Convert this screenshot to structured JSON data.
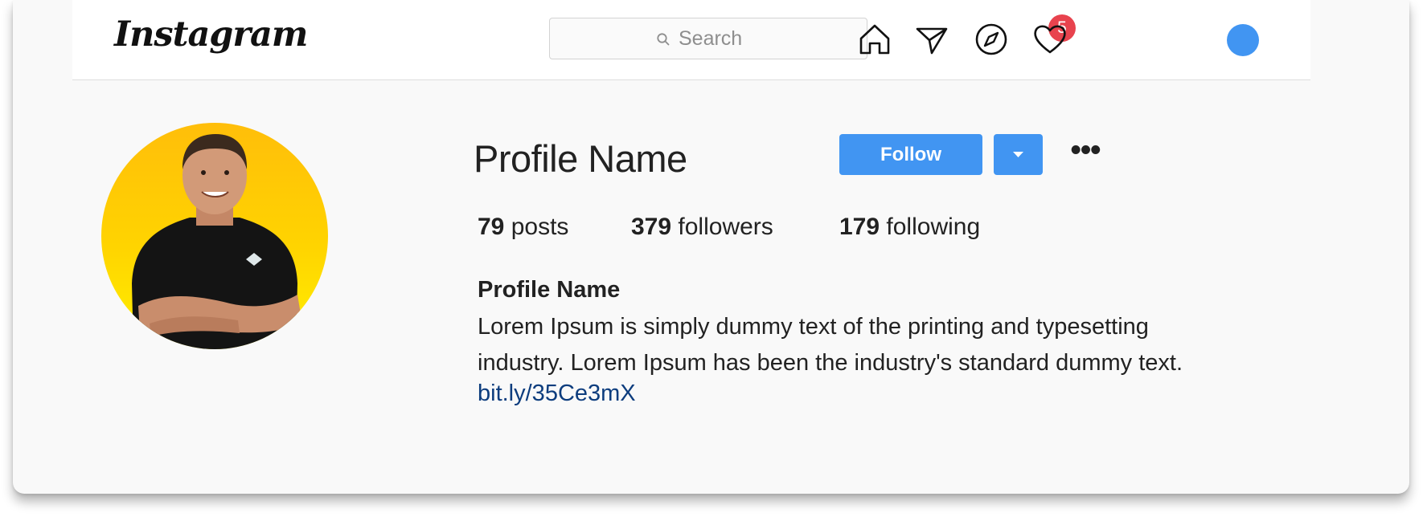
{
  "app": {
    "logo_text": "Instagram"
  },
  "search": {
    "placeholder": "Search"
  },
  "nav": {
    "icons": [
      "home-icon",
      "direct-messages-icon",
      "explore-compass-icon",
      "activity-heart-icon",
      "profile-avatar"
    ],
    "notification_count": "5",
    "accent_color": "#4195f2",
    "badge_color": "#e8434e"
  },
  "profile": {
    "name": "Profile Name",
    "follow_label": "Follow",
    "more_label": "•••",
    "stats": {
      "posts_count": "79",
      "posts_label": "posts",
      "followers_count": "379",
      "followers_label": "followers",
      "following_count": "179",
      "following_label": "following"
    },
    "bio": {
      "name": "Profile Name",
      "text_line1": "Lorem Ipsum is simply dummy text of the printing and typesetting",
      "text_line2": "industry. Lorem Ipsum has been the industry's standard dummy text.",
      "link": "bit.ly/35Ce3mX"
    }
  }
}
